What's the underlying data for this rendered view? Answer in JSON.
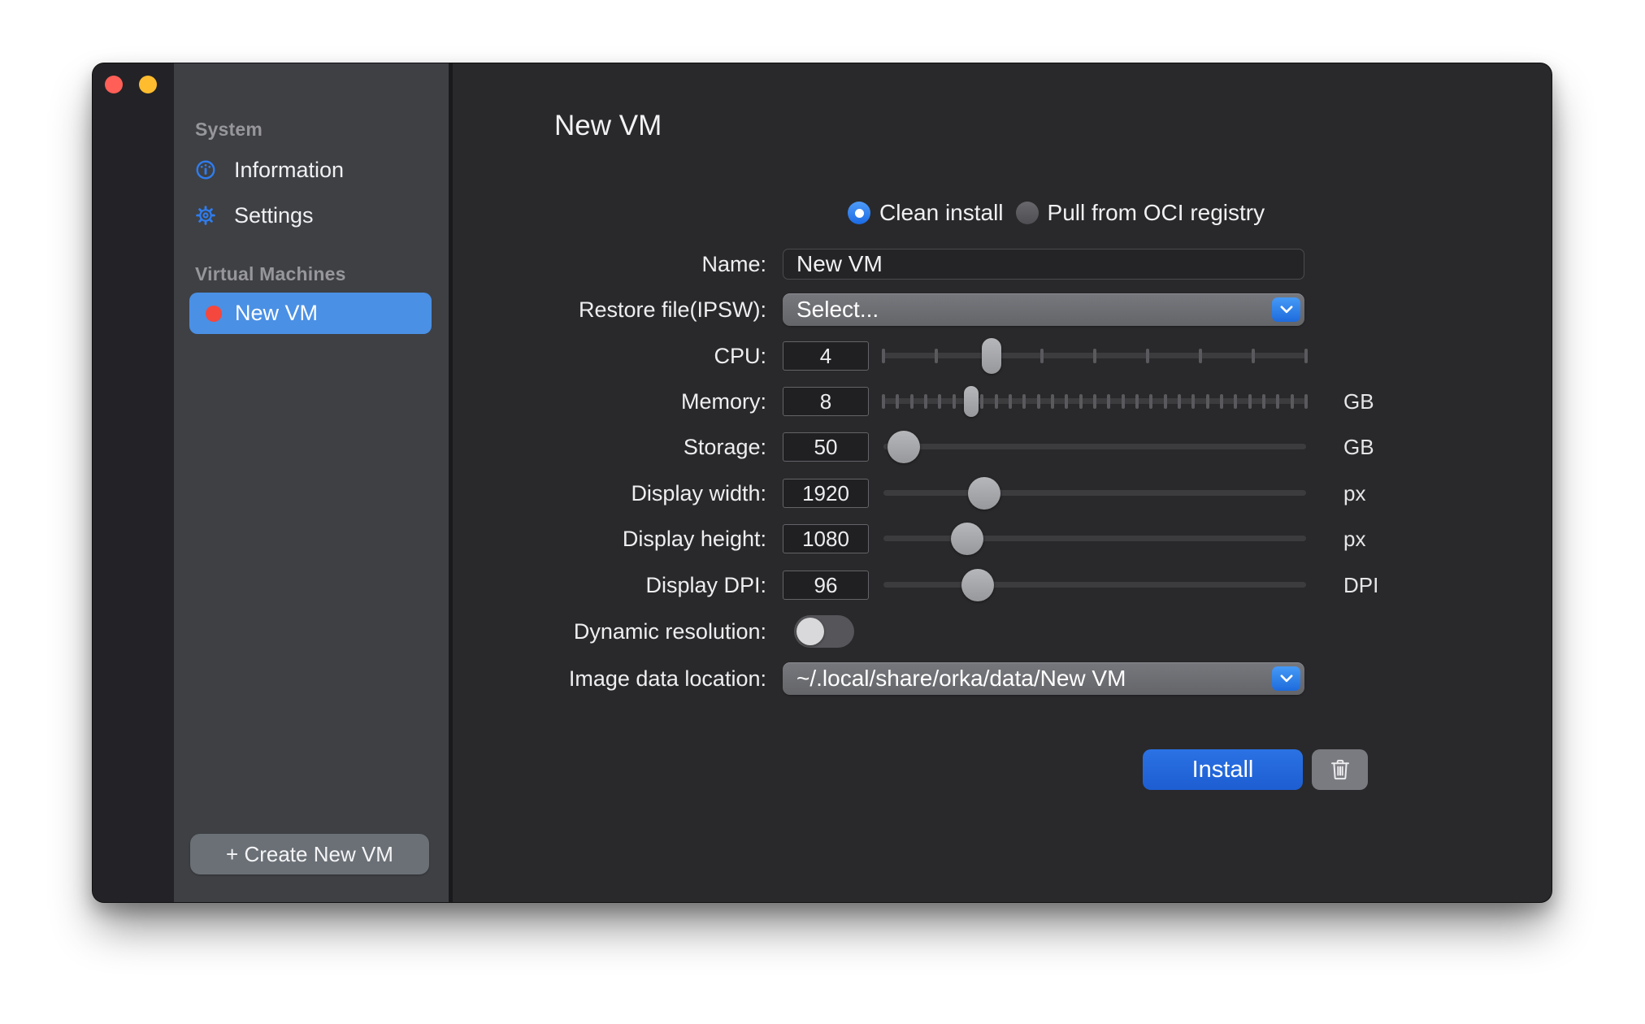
{
  "colors": {
    "accent_blue": "#2f7df0",
    "install_blue": "#2065d9",
    "selected_row_blue": "#4a90e5",
    "vm_status_red": "#f4473d",
    "traffic_red": "#ff5f57",
    "traffic_yellow": "#febc2e"
  },
  "sidebar": {
    "sections": [
      {
        "title": "System",
        "items": [
          {
            "label": "Information",
            "icon": "gauge-icon"
          },
          {
            "label": "Settings",
            "icon": "gear-icon"
          }
        ]
      },
      {
        "title": "Virtual Machines",
        "items": [
          {
            "label": "New VM",
            "icon": "status-dot",
            "selected": true
          }
        ]
      }
    ],
    "create_vm_button": "+ Create New VM"
  },
  "main": {
    "title": "New VM",
    "install_modes": [
      {
        "label": "Clean install",
        "selected": true
      },
      {
        "label": "Pull from OCI registry",
        "selected": false
      }
    ],
    "fields": {
      "name": {
        "label": "Name:",
        "value": "New VM"
      },
      "restore_file": {
        "label": "Restore file(IPSW):",
        "value": "Select..."
      },
      "cpu": {
        "label": "CPU:",
        "value": "4",
        "slider": {
          "fraction": 0.256,
          "ticks": 9,
          "knob": "capsule",
          "knob_w": 24,
          "knob_h": 44
        }
      },
      "memory": {
        "label": "Memory:",
        "value": "8",
        "suffix": "GB",
        "slider": {
          "fraction": 0.208,
          "ticks": 31,
          "knob": "capsule",
          "knob_w": 18,
          "knob_h": 38
        }
      },
      "storage": {
        "label": "Storage:",
        "value": "50",
        "suffix": "GB",
        "slider": {
          "fraction": 0.048,
          "knob": "round",
          "knob_w": 40,
          "knob_h": 40
        }
      },
      "display_width": {
        "label": "Display width:",
        "value": "1920",
        "suffix": "px",
        "slider": {
          "fraction": 0.238,
          "knob": "round",
          "knob_w": 40,
          "knob_h": 40
        }
      },
      "display_height": {
        "label": "Display height:",
        "value": "1080",
        "suffix": "px",
        "slider": {
          "fraction": 0.198,
          "knob": "round",
          "knob_w": 40,
          "knob_h": 40
        }
      },
      "display_dpi": {
        "label": "Display DPI:",
        "value": "96",
        "suffix": "DPI",
        "slider": {
          "fraction": 0.223,
          "knob": "round",
          "knob_w": 40,
          "knob_h": 40
        }
      },
      "dynamic_resolution": {
        "label": "Dynamic resolution:",
        "on": false
      },
      "image_data_location": {
        "label": "Image data location:",
        "value": "~/.local/share/orka/data/New VM"
      }
    },
    "install_button": "Install"
  }
}
